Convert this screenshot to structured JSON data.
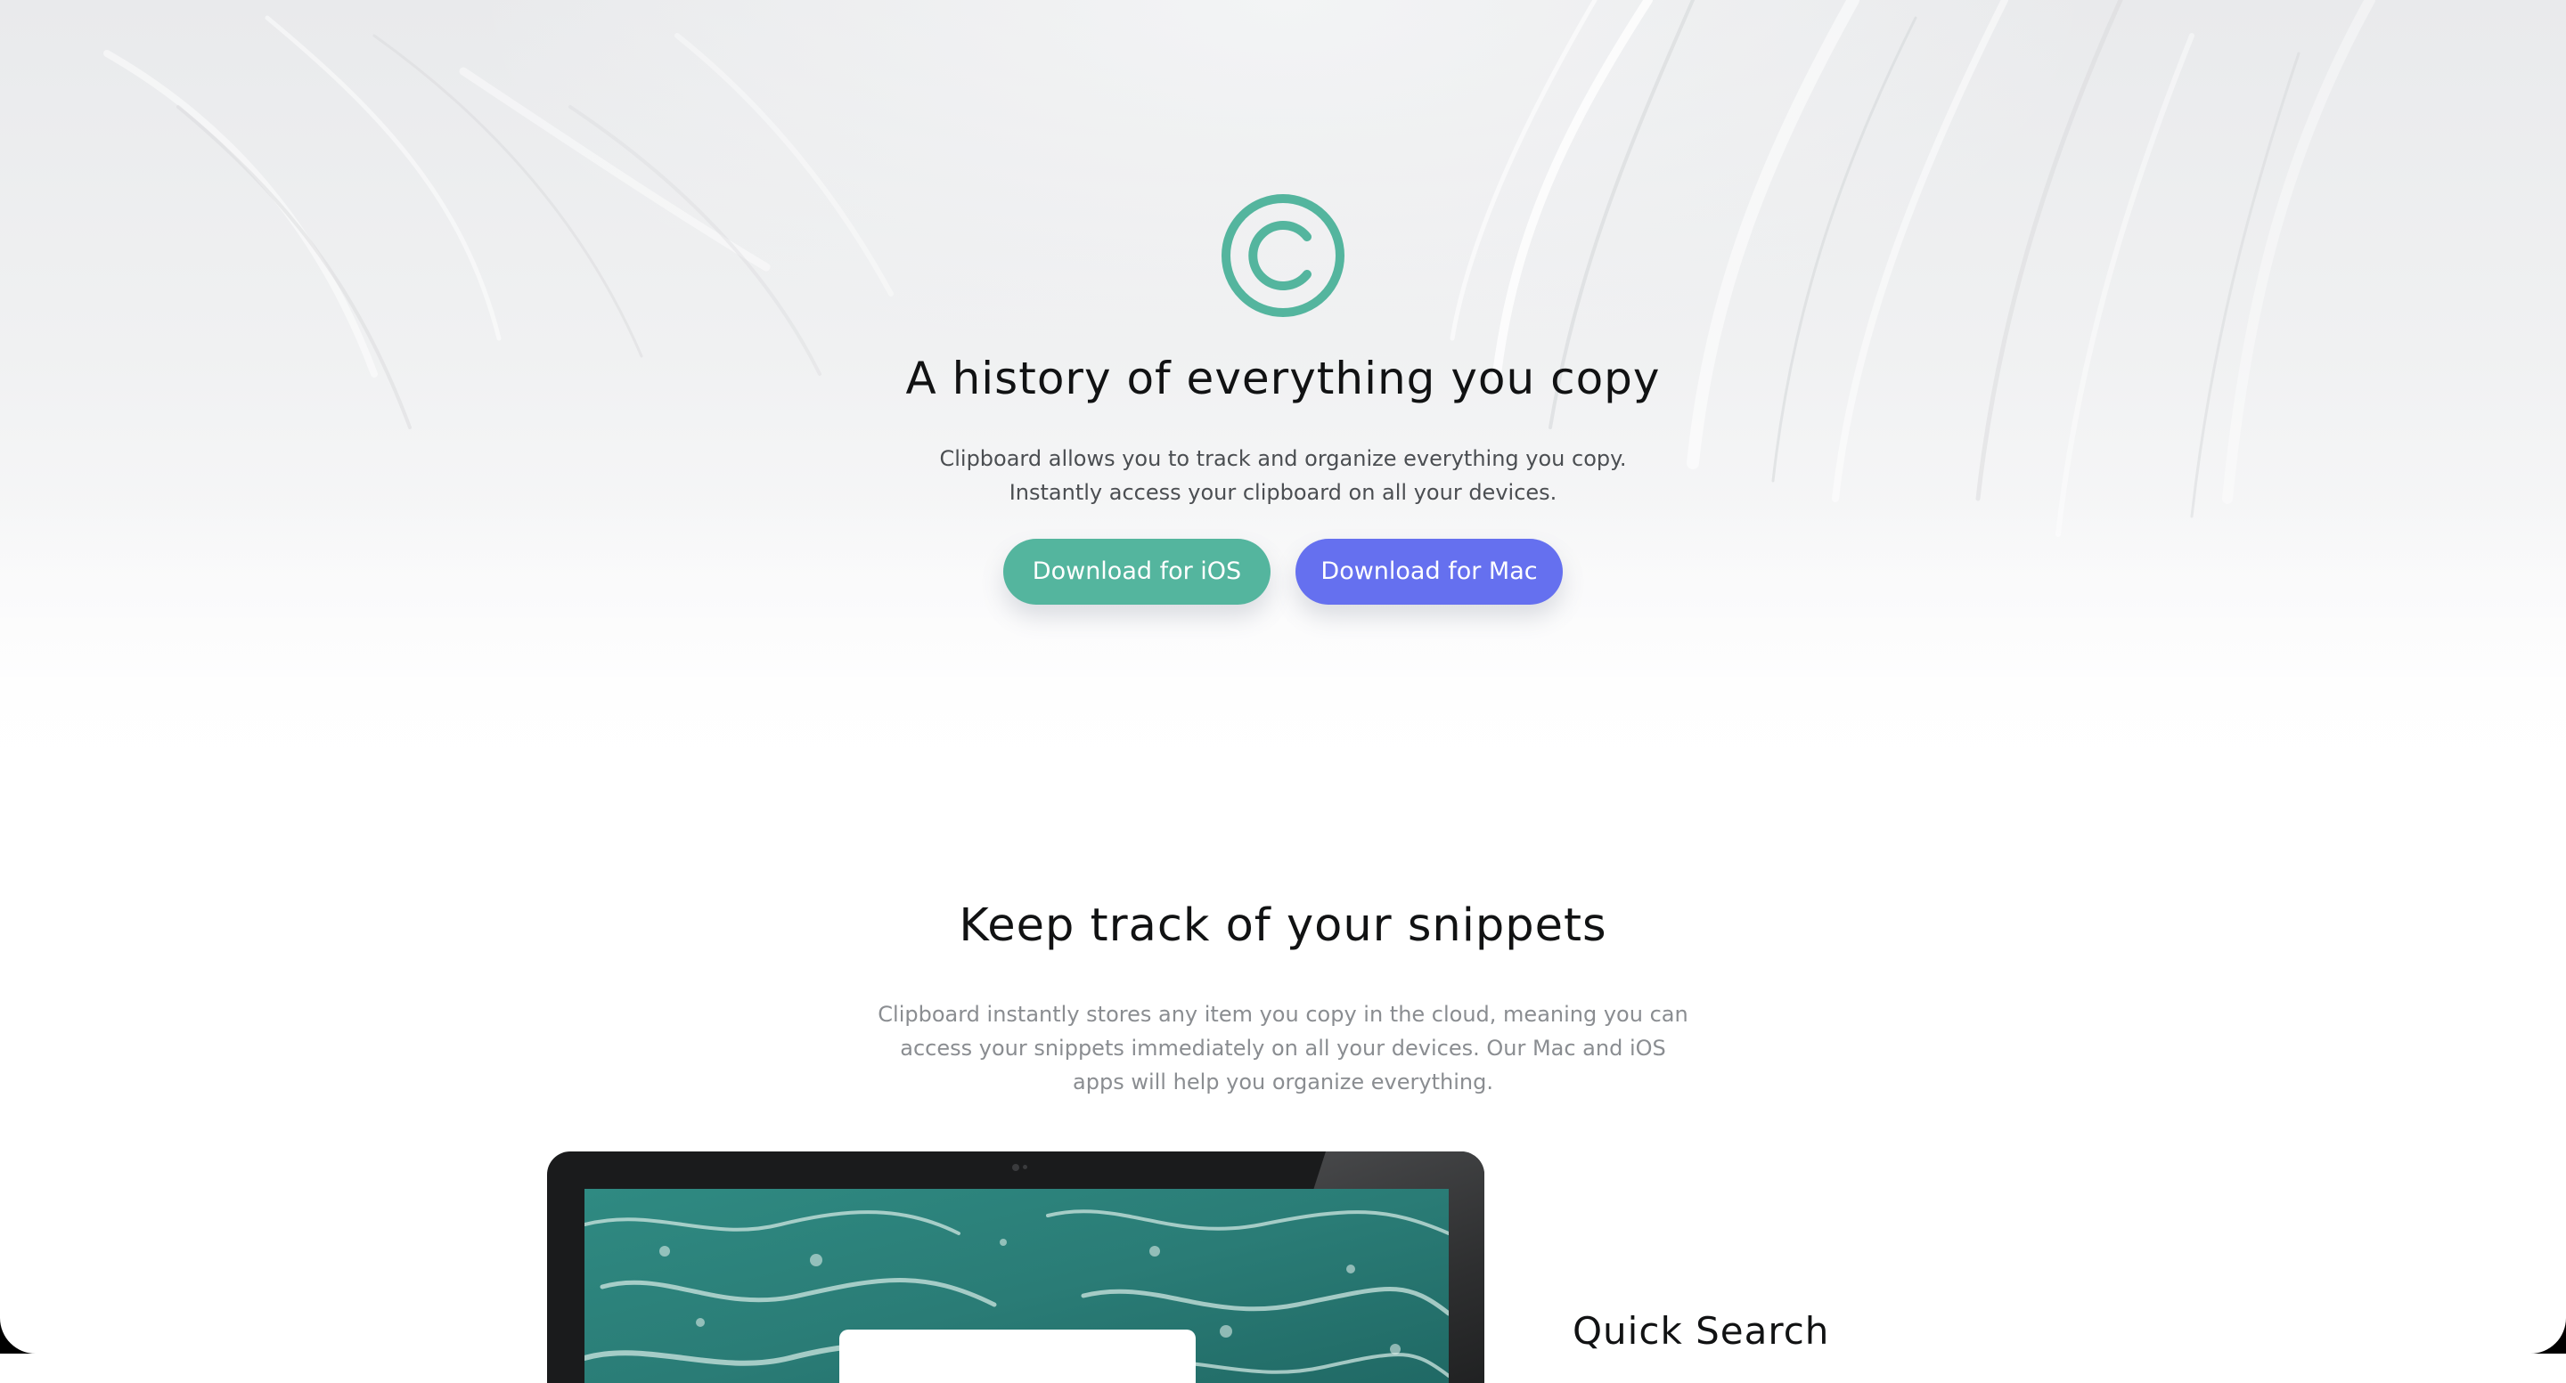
{
  "hero": {
    "logo_icon": "copyright-c-icon",
    "title": "A history of everything you copy",
    "subtitle": "Clipboard allows you to track and organize everything you copy. Instantly access your clipboard on all your devices.",
    "buttons": {
      "ios_label": "Download for iOS",
      "mac_label": "Download for Mac"
    }
  },
  "snippets": {
    "title": "Keep track of your snippets",
    "body": "Clipboard instantly stores any item you copy in the cloud, meaning you can access your snippets immediately on all your devices. Our Mac and iOS apps will help you organize everything."
  },
  "features": {
    "first_title": "Quick Search"
  },
  "colors": {
    "accent_green": "#54b59e",
    "accent_blue": "#6570ef",
    "heading": "#111213",
    "body_text": "#4b4e52",
    "muted_text": "#8a8d91",
    "device_bezel": "#1a1b1c"
  }
}
